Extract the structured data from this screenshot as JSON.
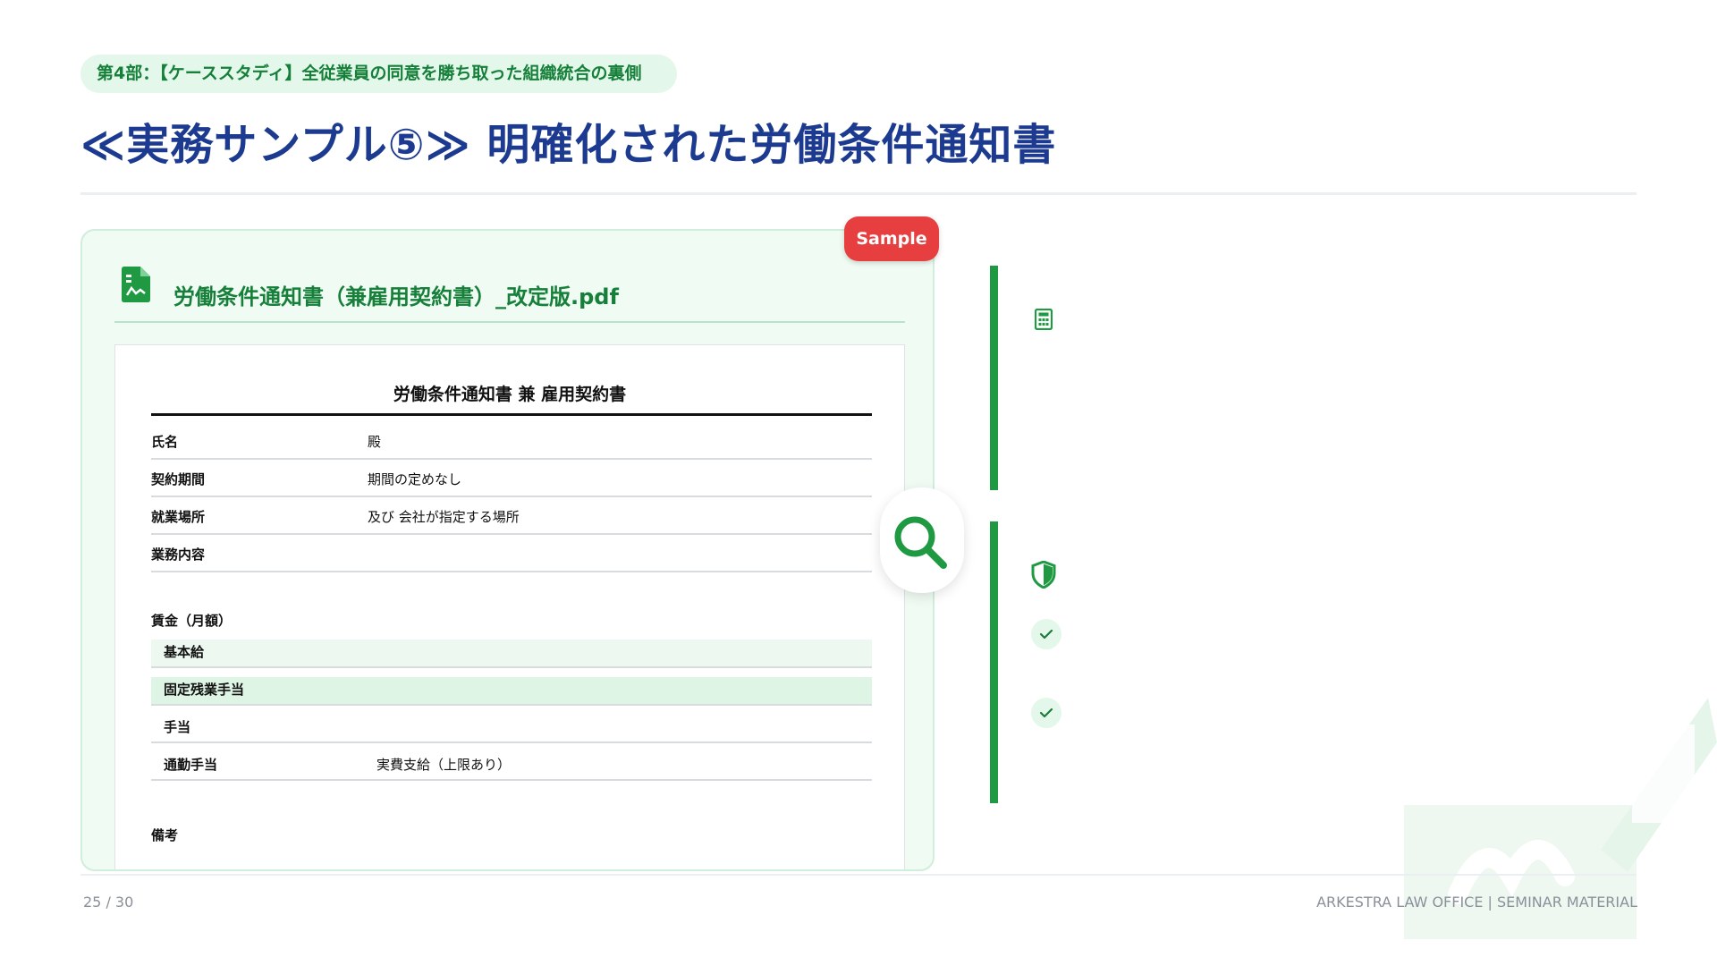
{
  "header": {
    "chip_text": "第4部：【ケーススタディ】全従業員の同意を勝ち取った組織統合の裏側",
    "title": "≪実務サンプル⑤≫ 明確化された労働条件通知書"
  },
  "document": {
    "badge": "Sample",
    "file_icon": "file-spreadsheet-icon",
    "file_name": "労働条件通知書（兼雇用契約書）_改定版.pdf",
    "paper_title": "労働条件通知書 兼 雇用契約書",
    "rows": [
      {
        "label": "氏名",
        "value": "殿"
      },
      {
        "label": "契約期間",
        "value": "期間の定めなし"
      },
      {
        "label": "就業場所",
        "value": "及び 会社が指定する場所"
      },
      {
        "label": "業務内容",
        "value": ""
      }
    ],
    "wage_section": "賃金（月額）",
    "wage_rows": [
      {
        "label": "基本給",
        "value": ""
      },
      {
        "label": "固定残業手当",
        "value": ""
      },
      {
        "label": "手当",
        "value": ""
      },
      {
        "label": "通勤手当",
        "value": "実費支給（上限あり）"
      }
    ],
    "remarks_label": "備考"
  },
  "side": {
    "icons": [
      "magnifier-icon",
      "calculator-icon",
      "shield-icon",
      "check-icon"
    ]
  },
  "footer": {
    "page": "25 / 30",
    "brand": "ARKESTRA LAW OFFICE | SEMINAR MATERIAL"
  },
  "colors": {
    "accent_green": "#1f9a42",
    "title_navy": "#1c3a8f",
    "badge_red": "#e73f3f"
  }
}
